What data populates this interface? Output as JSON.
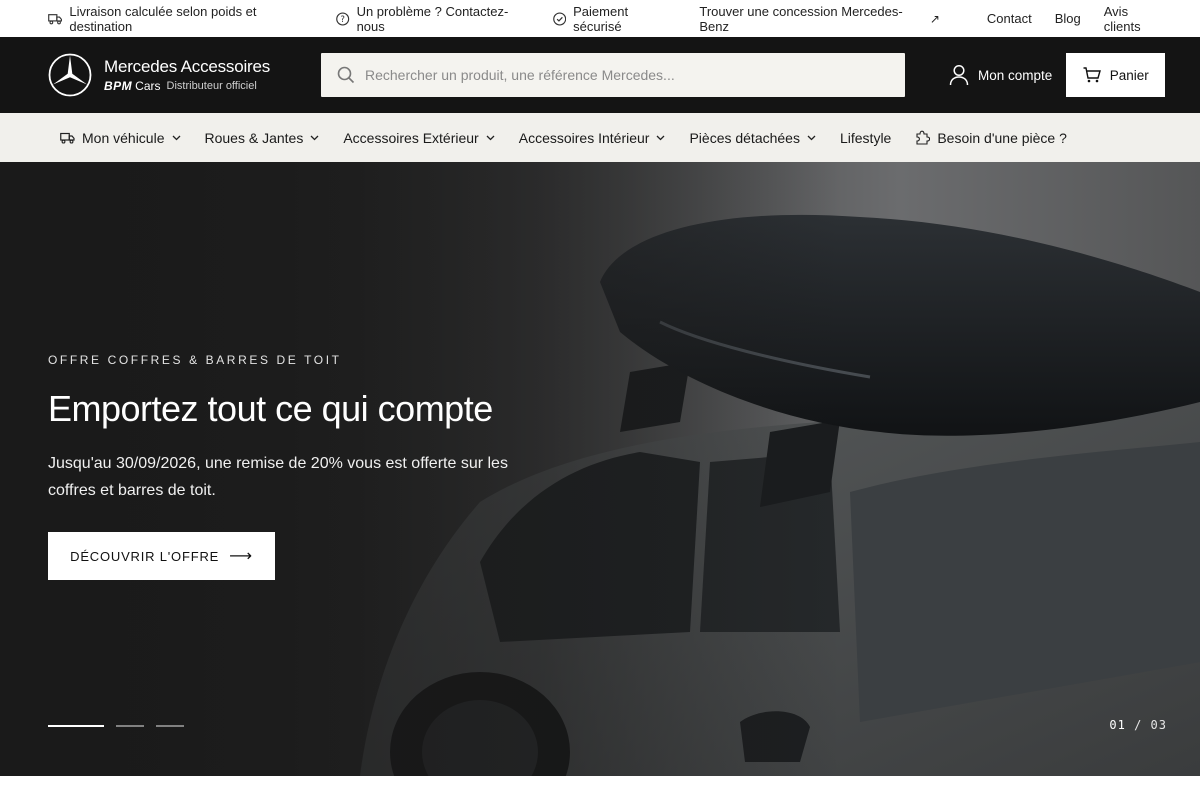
{
  "topbar": {
    "shipping": "Livraison calculée selon poids et destination",
    "help": "Un problème ? Contactez-nous",
    "payment": "Paiement sécurisé",
    "dealer": "Trouver une concession Mercedes-Benz",
    "links": [
      "Contact",
      "Blog",
      "Avis clients"
    ]
  },
  "header": {
    "brand_title": "Mercedes Accessoires",
    "brand_bpm": "BPM",
    "brand_cars": "Cars",
    "brand_dist": "Distributeur officiel",
    "search_placeholder": "Rechercher un produit, une référence Mercedes...",
    "account_label": "Mon compte",
    "cart_label": "Panier"
  },
  "nav": {
    "items": [
      {
        "label": "Mon véhicule",
        "icon": "truck-icon",
        "dropdown": true
      },
      {
        "label": "Roues & Jantes",
        "dropdown": true
      },
      {
        "label": "Accessoires Extérieur",
        "dropdown": true
      },
      {
        "label": "Accessoires Intérieur",
        "dropdown": true
      },
      {
        "label": "Pièces détachées",
        "dropdown": true
      },
      {
        "label": "Lifestyle",
        "dropdown": false
      },
      {
        "label": "Besoin d'une pièce ?",
        "icon": "puzzle-icon",
        "dropdown": false
      }
    ]
  },
  "hero": {
    "eyebrow": "OFFRE COFFRES & BARRES DE TOIT",
    "title": "Emportez tout ce qui compte",
    "description": "Jusqu'au 30/09/2026, une remise de 20% vous est offerte sur les coffres et barres de toit.",
    "cta_label": "DÉCOUVRIR L'OFFRE",
    "slide_current": "01",
    "slide_separator": "/",
    "slide_total": "03"
  },
  "colors": {
    "header_bg": "#141414",
    "nav_bg": "#f1f0ec",
    "search_bg": "#f4f3ef",
    "accent": "#ffffff"
  }
}
